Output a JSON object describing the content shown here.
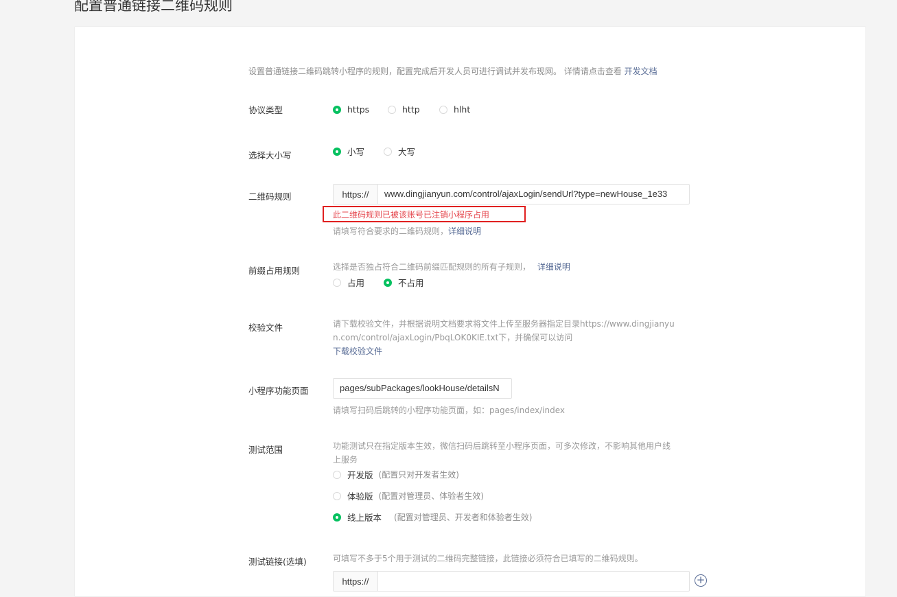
{
  "page_title": "配置普通链接二维码规则",
  "intro": {
    "text": "设置普通链接二维码跳转小程序的规则，配置完成后开发人员可进行调试并发布现网。 详情请点击查看",
    "link": "开发文档"
  },
  "protocol": {
    "label": "协议类型",
    "options": [
      "https",
      "http",
      "hlht"
    ],
    "selected": "https"
  },
  "case": {
    "label": "选择大小写",
    "options": [
      "小写",
      "大写"
    ],
    "selected": "小写"
  },
  "qr_rule": {
    "label": "二维码规则",
    "prefix": "https://",
    "value": "www.dingjianyun.com/control/ajaxLogin/sendUrl?type=newHouse_1e33",
    "error": "此二维码规则已被该账号已注销小程序占用",
    "hint": "请填写符合要求的二维码规则，",
    "hint_link": "详细说明"
  },
  "prefix_rule": {
    "label": "前缀占用规则",
    "hint": "选择是否独占符合二维码前缀匹配规则的所有子规则，",
    "hint_link": "详细说明",
    "options": [
      "占用",
      "不占用"
    ],
    "selected": "不占用"
  },
  "verify_file": {
    "label": "校验文件",
    "line1": "请下载校验文件，并根据说明文档要求将文件上传至服务器指定目录https://www.dingjianyu",
    "line2": "n.com/control/ajaxLogin/PbqLOK0KIE.txt下，并确保可以访问",
    "link": "下载校验文件"
  },
  "mini_page": {
    "label": "小程序功能页面",
    "value": "pages/subPackages/lookHouse/detailsN",
    "hint": "请填写扫码后跳转的小程序功能页面，如：pages/index/index"
  },
  "test_scope": {
    "label": "测试范围",
    "line1": "功能测试只在指定版本生效，微信扫码后跳转至小程序页面，可多次修改，不影响其他用户线",
    "line2": "上服务",
    "options": [
      {
        "name": "开发版",
        "desc": "(配置只对开发者生效)"
      },
      {
        "name": "体验版",
        "desc": "(配置对管理员、体验者生效)"
      },
      {
        "name": "线上版本",
        "desc": "(配置对管理员、开发者和体验者生效)"
      }
    ],
    "selected": "线上版本"
  },
  "test_link": {
    "label": "测试链接(选填)",
    "hint": "可填写不多于5个用于测试的二维码完整链接，此链接必须符合已填写的二维码规则。",
    "prefix": "https://",
    "value": "",
    "add": "+"
  },
  "colors": {
    "accent": "#07c160",
    "link": "#576b95",
    "error": "#e5474e",
    "error_box": "#e02020"
  }
}
